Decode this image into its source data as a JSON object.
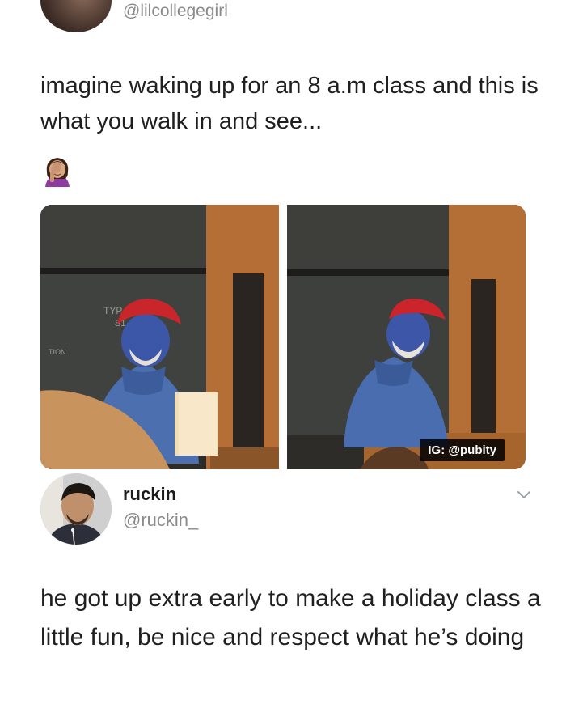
{
  "original_tweet": {
    "handle": "@lilcollegegirl",
    "text": "imagine waking up for an 8 a.m class and this is what you walk in and see...",
    "emoji_icon": "woman-facepalming-icon"
  },
  "media": {
    "watermark": "IG: @pubity",
    "images": [
      "professor-smurf-costume-photo-1",
      "professor-smurf-costume-photo-2"
    ]
  },
  "reply": {
    "name": "ruckin",
    "handle": "@ruckin_",
    "text": "he got up extra early to make a holiday class a little fun, be nice and respect what he’s doing",
    "menu_icon": "chevron-down-icon"
  },
  "colors": {
    "handle_gray": "#8a8a8a",
    "text": "#1f1f1f",
    "background": "#ffffff"
  }
}
